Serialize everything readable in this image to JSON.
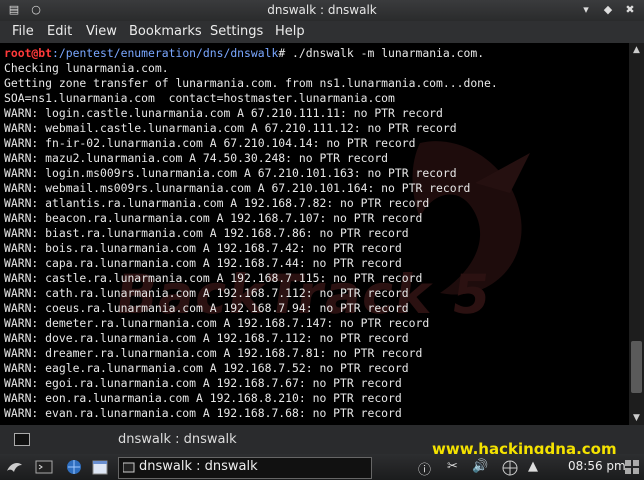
{
  "window": {
    "title": "dnswalk : dnswalk"
  },
  "menu": {
    "items": [
      "File",
      "Edit",
      "View",
      "Bookmarks",
      "Settings",
      "Help"
    ]
  },
  "terminal": {
    "prompt_user": "root@bt",
    "prompt_path": ":/pentest/enumeration/dns/dnswalk",
    "command": "# ./dnswalk -m lunarmania.com.",
    "watermark": "BackTrack 5",
    "lines": [
      "Checking lunarmania.com.",
      "Getting zone transfer of lunarmania.com. from ns1.lunarmania.com...done.",
      "SOA=ns1.lunarmania.com  contact=hostmaster.lunarmania.com",
      "WARN: login.castle.lunarmania.com A 67.210.111.11: no PTR record",
      "WARN: webmail.castle.lunarmania.com A 67.210.111.12: no PTR record",
      "WARN: fn-ir-02.lunarmania.com A 67.210.104.14: no PTR record",
      "WARN: mazu2.lunarmania.com A 74.50.30.248: no PTR record",
      "WARN: login.ms009rs.lunarmania.com A 67.210.101.163: no PTR record",
      "WARN: webmail.ms009rs.lunarmania.com A 67.210.101.164: no PTR record",
      "WARN: atlantis.ra.lunarmania.com A 192.168.7.82: no PTR record",
      "WARN: beacon.ra.lunarmania.com A 192.168.7.107: no PTR record",
      "WARN: biast.ra.lunarmania.com A 192.168.7.86: no PTR record",
      "WARN: bois.ra.lunarmania.com A 192.168.7.42: no PTR record",
      "WARN: capa.ra.lunarmania.com A 192.168.7.44: no PTR record",
      "WARN: castle.ra.lunarmania.com A 192.168.7.115: no PTR record",
      "WARN: cath.ra.lunarmania.com A 192.168.7.112: no PTR record",
      "WARN: coeus.ra.lunarmania.com A 192.168.7.94: no PTR record",
      "WARN: demeter.ra.lunarmania.com A 192.168.7.147: no PTR record",
      "WARN: dove.ra.lunarmania.com A 192.168.7.112: no PTR record",
      "WARN: dreamer.ra.lunarmania.com A 192.168.7.81: no PTR record",
      "WARN: eagle.ra.lunarmania.com A 192.168.7.52: no PTR record",
      "WARN: egoi.ra.lunarmania.com A 192.168.7.67: no PTR record",
      "WARN: eon.ra.lunarmania.com A 192.168.8.210: no PTR record",
      "WARN: evan.ra.lunarmania.com A 192.168.7.68: no PTR record"
    ]
  },
  "tab": {
    "label": "dnswalk : dnswalk"
  },
  "website": "www.hackingdna.com",
  "taskbar": {
    "task_label": "dnswalk : dnswalk",
    "clock": "08:56 pm"
  },
  "colors": {
    "prompt_user": "#ff3a3a",
    "prompt_path": "#7aa7ff",
    "terminal_text": "#e8e8e8",
    "website": "#f4e200"
  }
}
